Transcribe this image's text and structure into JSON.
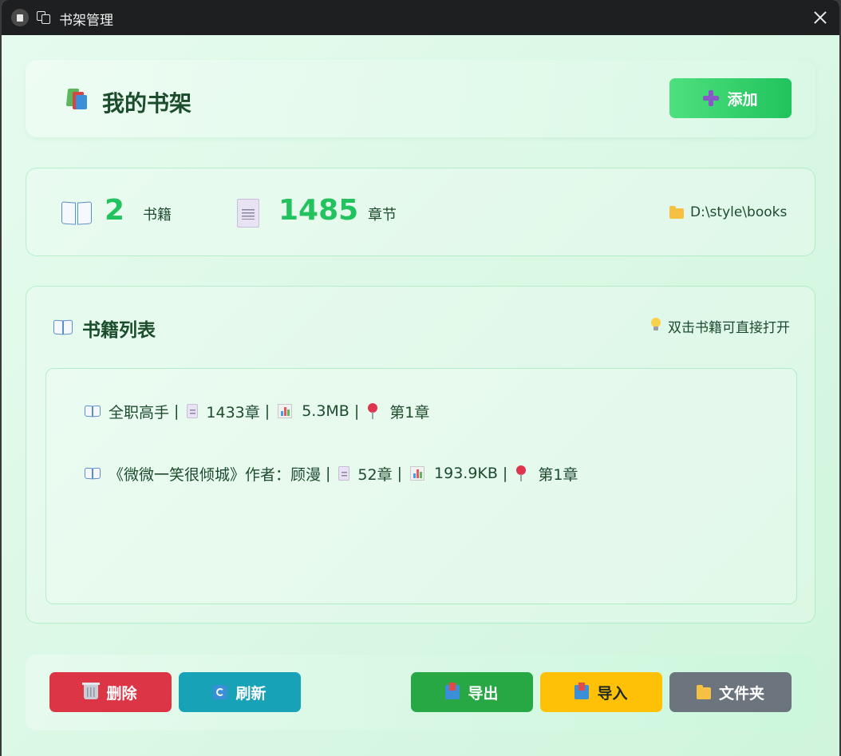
{
  "window": {
    "title": "书架管理"
  },
  "header": {
    "title": "我的书架",
    "add_label": "添加"
  },
  "stats": {
    "books_count": "2",
    "books_label": "书籍",
    "chapters_count": "1485",
    "chapters_label": "章节",
    "path": "D:\\style\\books"
  },
  "list": {
    "title": "书籍列表",
    "hint": "双击书籍可直接打开",
    "items": [
      {
        "name": "全职高手",
        "chapters": "1433章",
        "size": "5.3MB",
        "progress": "第1章"
      },
      {
        "name": "《微微一笑很倾城》作者：顾漫",
        "chapters": "52章",
        "size": "193.9KB",
        "progress": "第1章"
      }
    ],
    "separator": "|"
  },
  "footer": {
    "delete_label": "删除",
    "refresh_label": "刷新",
    "export_label": "导出",
    "import_label": "导入",
    "folder_label": "文件夹"
  },
  "colors": {
    "accent": "#22c35e",
    "delete": "#dc3545",
    "refresh": "#17a2b8",
    "export": "#28a745",
    "import": "#ffc107",
    "folder": "#6c757d"
  }
}
